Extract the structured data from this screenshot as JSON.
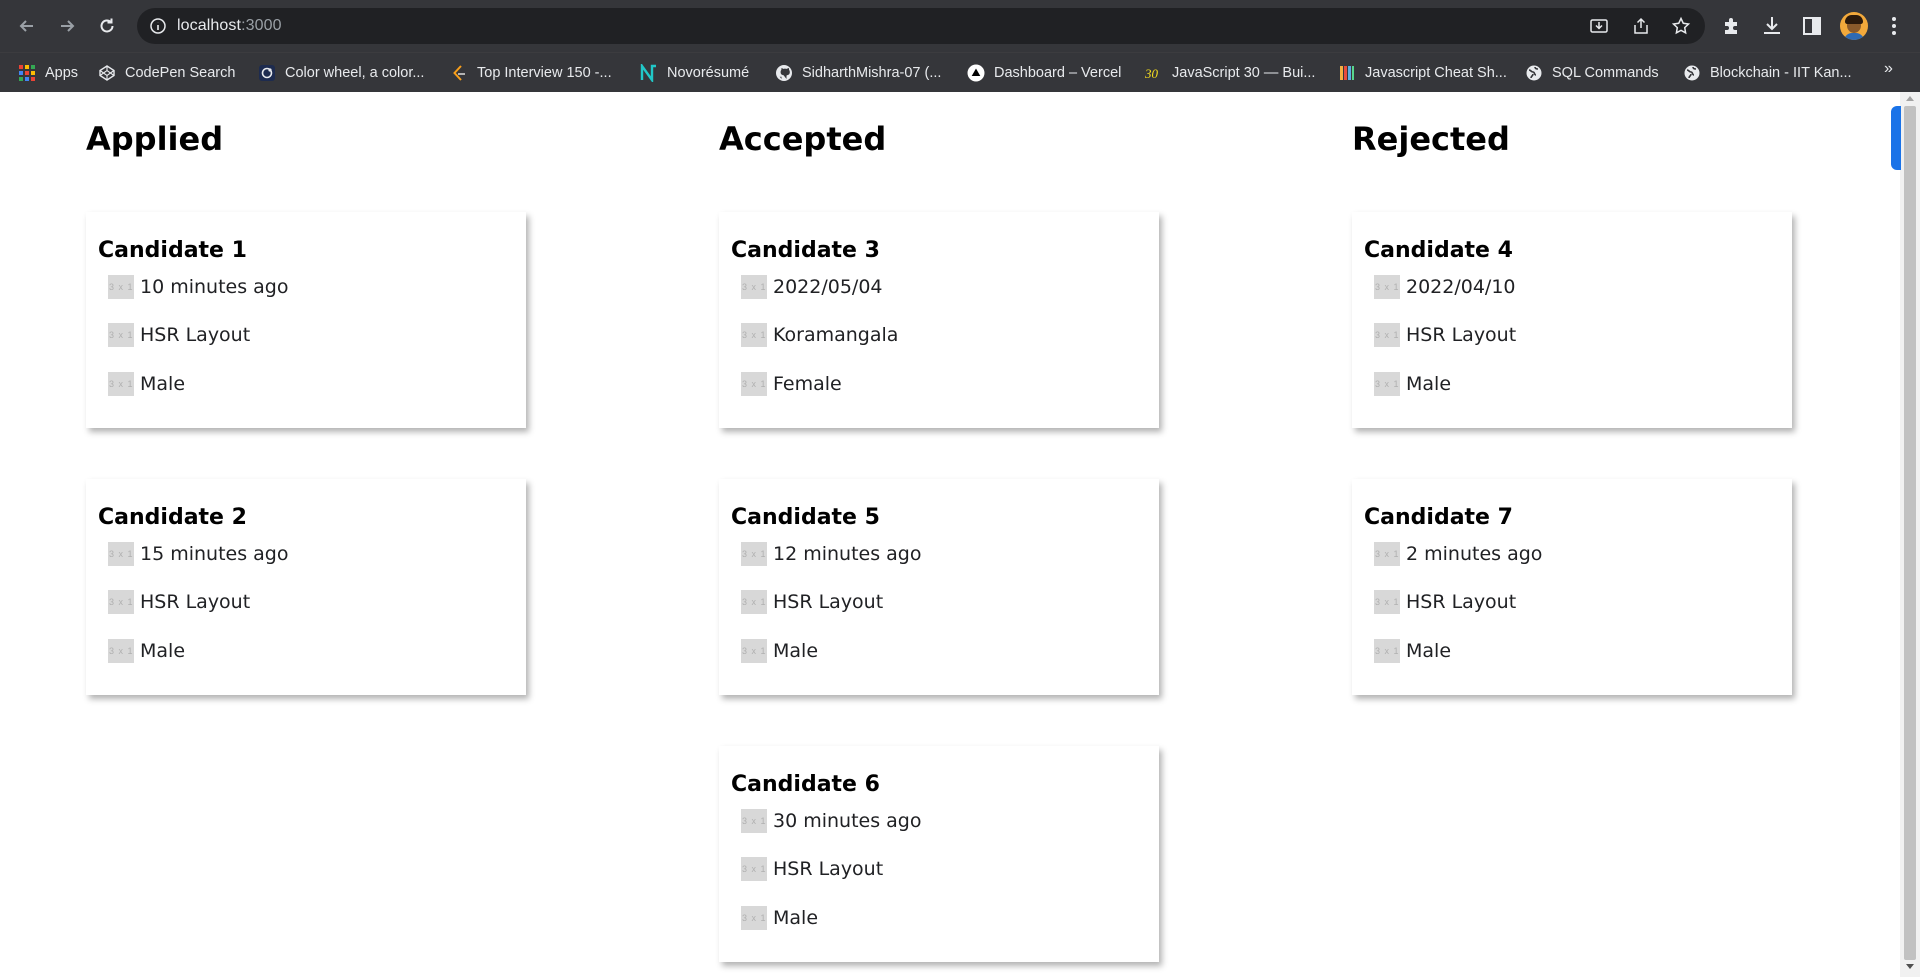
{
  "browser": {
    "url_host": "localhost",
    "url_port": ":3000",
    "bookmarks": [
      {
        "label": "Apps",
        "icon": "apps-grid-icon"
      },
      {
        "label": "CodePen Search",
        "icon": "codepen-icon"
      },
      {
        "label": "Color wheel, a color...",
        "icon": "color-wheel-icon"
      },
      {
        "label": "Top Interview 150 -...",
        "icon": "leetcode-icon"
      },
      {
        "label": "Novorésumé",
        "icon": "novoresume-icon"
      },
      {
        "label": "SidharthMishra-07 (...",
        "icon": "github-icon"
      },
      {
        "label": "Dashboard – Vercel",
        "icon": "vercel-icon"
      },
      {
        "label": "JavaScript 30 — Bui...",
        "icon": "javascript30-icon"
      },
      {
        "label": "Javascript Cheat Sh...",
        "icon": "cheatsheet-icon"
      },
      {
        "label": "SQL Commands",
        "icon": "globe-icon"
      },
      {
        "label": "Blockchain - IIT Kan...",
        "icon": "globe-icon"
      }
    ],
    "bookmarks_more": "»"
  },
  "placeholder_text": "3 x 1",
  "columns": [
    {
      "title": "Applied",
      "cards": [
        {
          "name": "Candidate 1",
          "time": "10 minutes ago",
          "location": "HSR Layout",
          "gender": "Male"
        },
        {
          "name": "Candidate 2",
          "time": "15 minutes ago",
          "location": "HSR Layout",
          "gender": "Male"
        }
      ]
    },
    {
      "title": "Accepted",
      "cards": [
        {
          "name": "Candidate 3",
          "time": "2022/05/04",
          "location": "Koramangala",
          "gender": "Female"
        },
        {
          "name": "Candidate 5",
          "time": "12 minutes ago",
          "location": "HSR Layout",
          "gender": "Male"
        },
        {
          "name": "Candidate 6",
          "time": "30 minutes ago",
          "location": "HSR Layout",
          "gender": "Male"
        }
      ]
    },
    {
      "title": "Rejected",
      "cards": [
        {
          "name": "Candidate 4",
          "time": "2022/04/10",
          "location": "HSR Layout",
          "gender": "Male"
        },
        {
          "name": "Candidate 7",
          "time": "2 minutes ago",
          "location": "HSR Layout",
          "gender": "Male"
        }
      ]
    }
  ]
}
